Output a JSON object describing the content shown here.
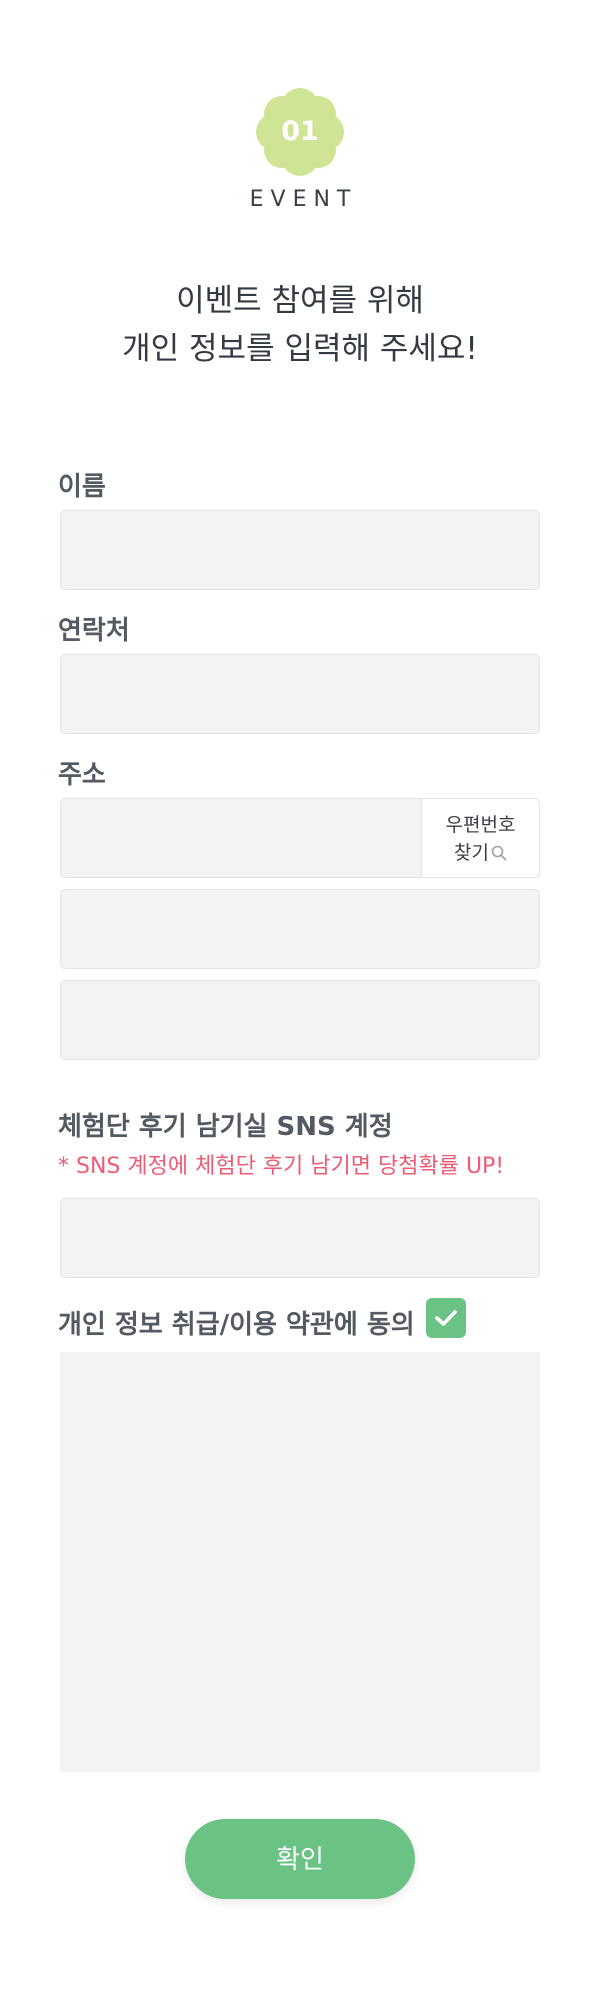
{
  "badge": {
    "number": "01",
    "label": "EVENT",
    "color": "#cfe595"
  },
  "headline": {
    "line1": "이벤트 참여를 위해",
    "line2": "개인 정보를 입력해 주세요!"
  },
  "form": {
    "name_label": "이름",
    "contact_label": "연락처",
    "address_label": "주소",
    "zip_button_line1": "우편번호",
    "zip_button_line2": "찾기",
    "sns_label": "체험단 후기 남기실 SNS 계정",
    "sns_promo": "* SNS 계정에 체험단 후기 남기면 당첨확률 UP!",
    "terms_label": "개인 정보 취급/이용 약관에 동의",
    "terms_checked": true
  },
  "confirm_button": "확인",
  "colors": {
    "accent": "#6ac384",
    "promo": "#ef5b72",
    "field_bg": "#f3f3f3"
  }
}
